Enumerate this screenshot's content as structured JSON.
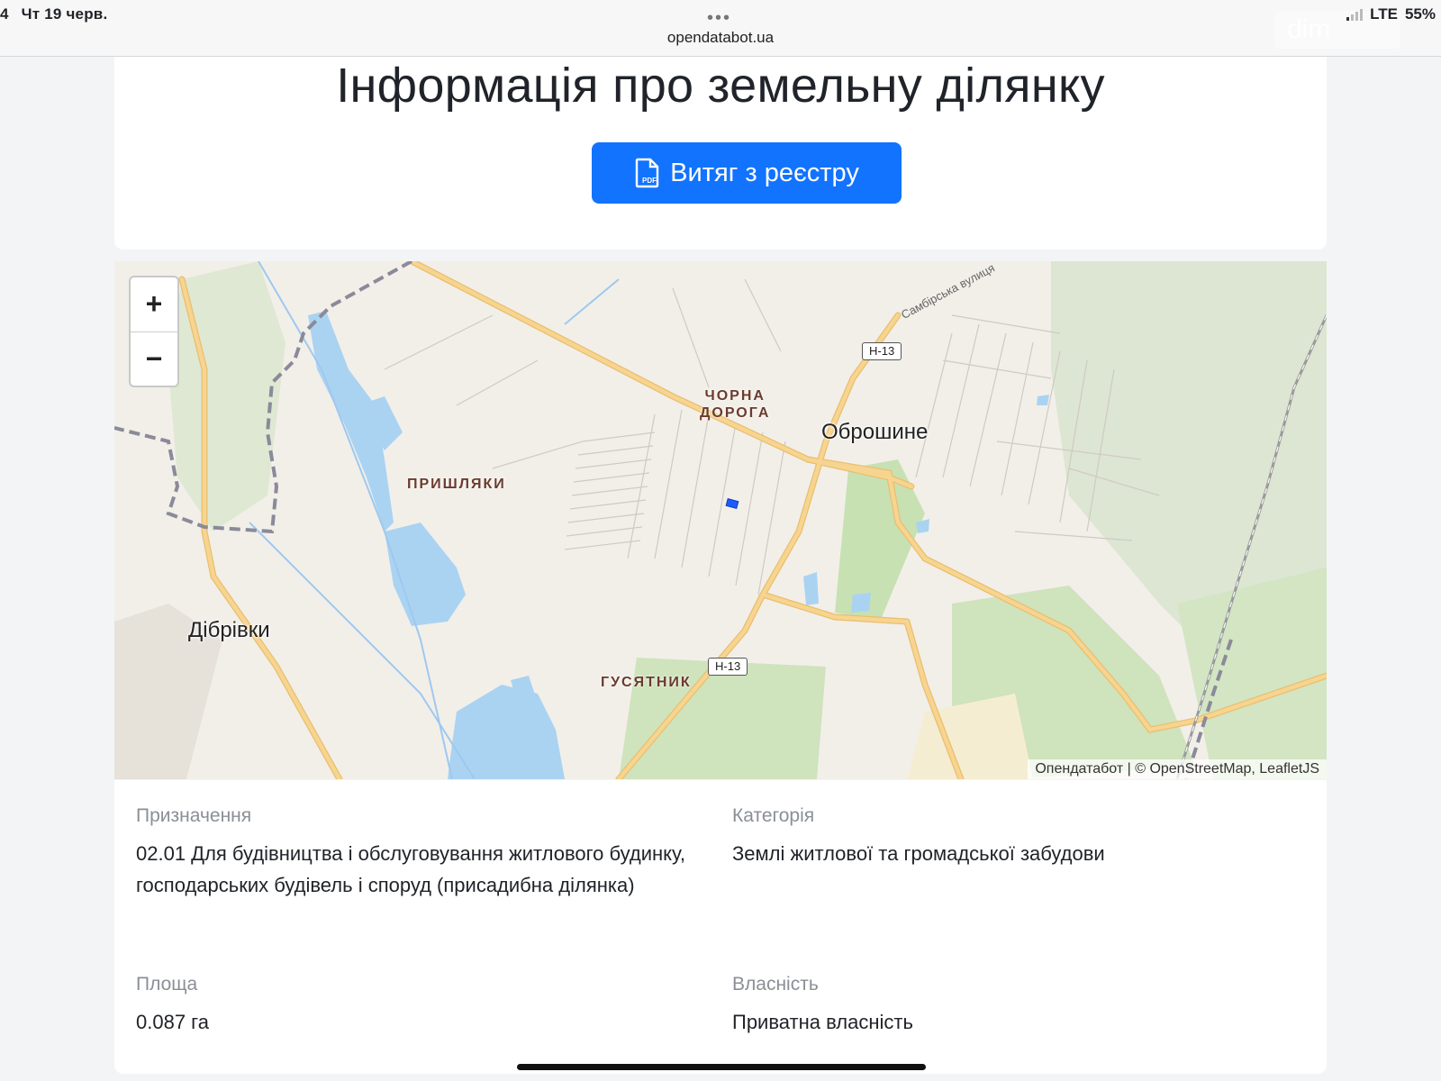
{
  "status_bar": {
    "left_fragment": "4",
    "date": "Чт 19 черв.",
    "dots": "•••",
    "url": "opendatabot.ua",
    "network": "LTE",
    "battery": "55%",
    "watermark": "dim"
  },
  "header": {
    "title": "Інформація про земельну ділянку",
    "extract_button_label": "Витяг з реєстру",
    "pdf_badge": "PDF"
  },
  "map": {
    "zoom_in_label": "+",
    "zoom_out_label": "−",
    "labels": {
      "obroshyne": "Оброшине",
      "dibrivky": "Дібрівки",
      "chorna_doroha_line1": "ЧОРНА",
      "chorna_doroha_line2": "ДОРОГА",
      "pryshlyaky": "ПРИШЛЯКИ",
      "husyatnyk": "ГУСЯТНИК",
      "sambirska_street": "Самбірська вулиця",
      "road_h13_north": "Н-13",
      "road_h13_south": "Н-13"
    },
    "attribution": "Опендатабот | © OpenStreetMap, LeafletJS",
    "colors": {
      "land": "#f2efe9",
      "water": "#aad3f2",
      "forest": "#d6e8c8",
      "road": "#f7d48f",
      "boundary": "#8a8a9a",
      "parcel": "#1a5cff"
    }
  },
  "details": {
    "purpose_label": "Призначення",
    "purpose_value": "02.01 Для будівництва і обслуговування житлового будинку, господарських будівель і споруд (присадибна ділянка)",
    "category_label": "Категорія",
    "category_value": "Землі житлової та громадської забудови",
    "area_label": "Площа",
    "area_value": "0.087 га",
    "ownership_label": "Власність",
    "ownership_value": "Приватна власність"
  }
}
